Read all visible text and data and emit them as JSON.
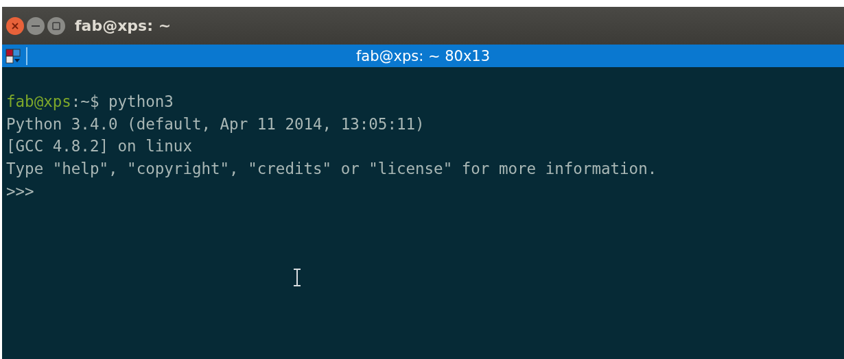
{
  "window": {
    "title": "fab@xps: ~"
  },
  "tab_bar": {
    "title": "fab@xps: ~ 80x13"
  },
  "terminal": {
    "lines": [
      {
        "kind": "prompt",
        "user_host": "fab@xps",
        "path": ":~$",
        "command": "python3"
      },
      {
        "kind": "output",
        "text": "Python 3.4.0 (default, Apr 11 2014, 13:05:11)"
      },
      {
        "kind": "output",
        "text": "[GCC 4.8.2] on linux"
      },
      {
        "kind": "output",
        "text": "Type \"help\", \"copyright\", \"credits\" or \"license\" for more information."
      },
      {
        "kind": "output",
        "text": ">>>"
      }
    ]
  }
}
